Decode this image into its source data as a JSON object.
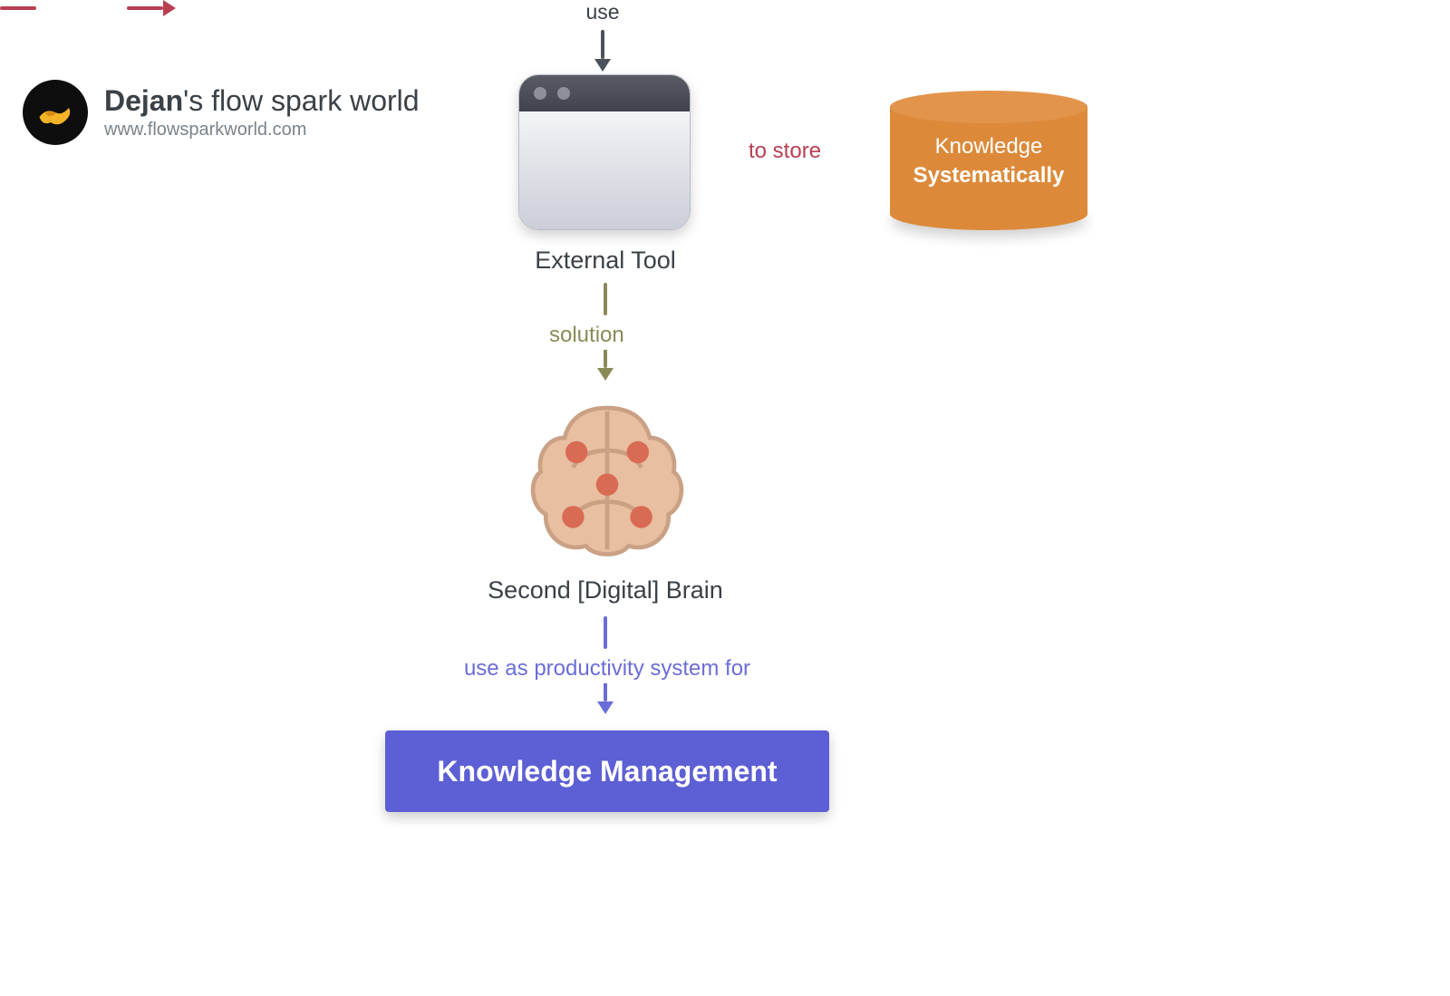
{
  "brand": {
    "bold": "Dejan",
    "rest": "'s flow spark world",
    "url": "www.flowsparkworld.com"
  },
  "nodes": {
    "external_tool": "External Tool",
    "second_brain": "Second [Digital] Brain",
    "knowledge_management": "Knowledge Management",
    "cylinder_line1": "Knowledge",
    "cylinder_line2": "Systematically"
  },
  "edges": {
    "use": "use",
    "to_store": "to store",
    "solution": "solution",
    "productivity": "use as productivity system for"
  },
  "colors": {
    "dark": "#3a4147",
    "olive": "#8a8a58",
    "red": "#b83f51",
    "purple": "#6b6dd8",
    "orange": "#dc8a3a",
    "box": "#5d5fd4"
  }
}
